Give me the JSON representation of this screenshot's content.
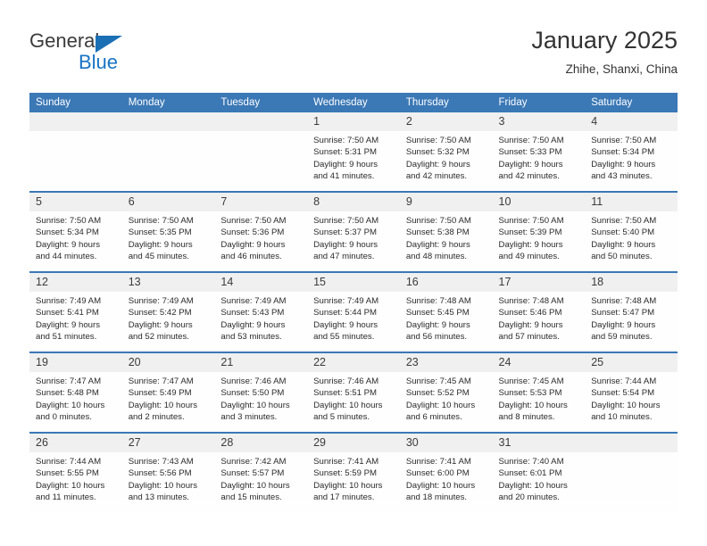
{
  "logo": {
    "word_top": "General",
    "word_bottom": "Blue",
    "triangle_icon": "triangle-icon",
    "accent_color": "#1874c4"
  },
  "header": {
    "title": "January 2025",
    "location": "Zhihe, Shanxi, China"
  },
  "calendar": {
    "header_bg": "#3b78b6",
    "daynum_bg": "#f0f0f0",
    "weekdays": [
      "Sunday",
      "Monday",
      "Tuesday",
      "Wednesday",
      "Thursday",
      "Friday",
      "Saturday"
    ],
    "weeks": [
      [
        {
          "day": "",
          "sunrise": "",
          "sunset": "",
          "daylight_line1": "",
          "daylight_line2": "",
          "empty": true
        },
        {
          "day": "",
          "sunrise": "",
          "sunset": "",
          "daylight_line1": "",
          "daylight_line2": "",
          "empty": true
        },
        {
          "day": "",
          "sunrise": "",
          "sunset": "",
          "daylight_line1": "",
          "daylight_line2": "",
          "empty": true
        },
        {
          "day": "1",
          "sunrise": "Sunrise: 7:50 AM",
          "sunset": "Sunset: 5:31 PM",
          "daylight_line1": "Daylight: 9 hours",
          "daylight_line2": "and 41 minutes."
        },
        {
          "day": "2",
          "sunrise": "Sunrise: 7:50 AM",
          "sunset": "Sunset: 5:32 PM",
          "daylight_line1": "Daylight: 9 hours",
          "daylight_line2": "and 42 minutes."
        },
        {
          "day": "3",
          "sunrise": "Sunrise: 7:50 AM",
          "sunset": "Sunset: 5:33 PM",
          "daylight_line1": "Daylight: 9 hours",
          "daylight_line2": "and 42 minutes."
        },
        {
          "day": "4",
          "sunrise": "Sunrise: 7:50 AM",
          "sunset": "Sunset: 5:34 PM",
          "daylight_line1": "Daylight: 9 hours",
          "daylight_line2": "and 43 minutes."
        }
      ],
      [
        {
          "day": "5",
          "sunrise": "Sunrise: 7:50 AM",
          "sunset": "Sunset: 5:34 PM",
          "daylight_line1": "Daylight: 9 hours",
          "daylight_line2": "and 44 minutes."
        },
        {
          "day": "6",
          "sunrise": "Sunrise: 7:50 AM",
          "sunset": "Sunset: 5:35 PM",
          "daylight_line1": "Daylight: 9 hours",
          "daylight_line2": "and 45 minutes."
        },
        {
          "day": "7",
          "sunrise": "Sunrise: 7:50 AM",
          "sunset": "Sunset: 5:36 PM",
          "daylight_line1": "Daylight: 9 hours",
          "daylight_line2": "and 46 minutes."
        },
        {
          "day": "8",
          "sunrise": "Sunrise: 7:50 AM",
          "sunset": "Sunset: 5:37 PM",
          "daylight_line1": "Daylight: 9 hours",
          "daylight_line2": "and 47 minutes."
        },
        {
          "day": "9",
          "sunrise": "Sunrise: 7:50 AM",
          "sunset": "Sunset: 5:38 PM",
          "daylight_line1": "Daylight: 9 hours",
          "daylight_line2": "and 48 minutes."
        },
        {
          "day": "10",
          "sunrise": "Sunrise: 7:50 AM",
          "sunset": "Sunset: 5:39 PM",
          "daylight_line1": "Daylight: 9 hours",
          "daylight_line2": "and 49 minutes."
        },
        {
          "day": "11",
          "sunrise": "Sunrise: 7:50 AM",
          "sunset": "Sunset: 5:40 PM",
          "daylight_line1": "Daylight: 9 hours",
          "daylight_line2": "and 50 minutes."
        }
      ],
      [
        {
          "day": "12",
          "sunrise": "Sunrise: 7:49 AM",
          "sunset": "Sunset: 5:41 PM",
          "daylight_line1": "Daylight: 9 hours",
          "daylight_line2": "and 51 minutes."
        },
        {
          "day": "13",
          "sunrise": "Sunrise: 7:49 AM",
          "sunset": "Sunset: 5:42 PM",
          "daylight_line1": "Daylight: 9 hours",
          "daylight_line2": "and 52 minutes."
        },
        {
          "day": "14",
          "sunrise": "Sunrise: 7:49 AM",
          "sunset": "Sunset: 5:43 PM",
          "daylight_line1": "Daylight: 9 hours",
          "daylight_line2": "and 53 minutes."
        },
        {
          "day": "15",
          "sunrise": "Sunrise: 7:49 AM",
          "sunset": "Sunset: 5:44 PM",
          "daylight_line1": "Daylight: 9 hours",
          "daylight_line2": "and 55 minutes."
        },
        {
          "day": "16",
          "sunrise": "Sunrise: 7:48 AM",
          "sunset": "Sunset: 5:45 PM",
          "daylight_line1": "Daylight: 9 hours",
          "daylight_line2": "and 56 minutes."
        },
        {
          "day": "17",
          "sunrise": "Sunrise: 7:48 AM",
          "sunset": "Sunset: 5:46 PM",
          "daylight_line1": "Daylight: 9 hours",
          "daylight_line2": "and 57 minutes."
        },
        {
          "day": "18",
          "sunrise": "Sunrise: 7:48 AM",
          "sunset": "Sunset: 5:47 PM",
          "daylight_line1": "Daylight: 9 hours",
          "daylight_line2": "and 59 minutes."
        }
      ],
      [
        {
          "day": "19",
          "sunrise": "Sunrise: 7:47 AM",
          "sunset": "Sunset: 5:48 PM",
          "daylight_line1": "Daylight: 10 hours",
          "daylight_line2": "and 0 minutes."
        },
        {
          "day": "20",
          "sunrise": "Sunrise: 7:47 AM",
          "sunset": "Sunset: 5:49 PM",
          "daylight_line1": "Daylight: 10 hours",
          "daylight_line2": "and 2 minutes."
        },
        {
          "day": "21",
          "sunrise": "Sunrise: 7:46 AM",
          "sunset": "Sunset: 5:50 PM",
          "daylight_line1": "Daylight: 10 hours",
          "daylight_line2": "and 3 minutes."
        },
        {
          "day": "22",
          "sunrise": "Sunrise: 7:46 AM",
          "sunset": "Sunset: 5:51 PM",
          "daylight_line1": "Daylight: 10 hours",
          "daylight_line2": "and 5 minutes."
        },
        {
          "day": "23",
          "sunrise": "Sunrise: 7:45 AM",
          "sunset": "Sunset: 5:52 PM",
          "daylight_line1": "Daylight: 10 hours",
          "daylight_line2": "and 6 minutes."
        },
        {
          "day": "24",
          "sunrise": "Sunrise: 7:45 AM",
          "sunset": "Sunset: 5:53 PM",
          "daylight_line1": "Daylight: 10 hours",
          "daylight_line2": "and 8 minutes."
        },
        {
          "day": "25",
          "sunrise": "Sunrise: 7:44 AM",
          "sunset": "Sunset: 5:54 PM",
          "daylight_line1": "Daylight: 10 hours",
          "daylight_line2": "and 10 minutes."
        }
      ],
      [
        {
          "day": "26",
          "sunrise": "Sunrise: 7:44 AM",
          "sunset": "Sunset: 5:55 PM",
          "daylight_line1": "Daylight: 10 hours",
          "daylight_line2": "and 11 minutes."
        },
        {
          "day": "27",
          "sunrise": "Sunrise: 7:43 AM",
          "sunset": "Sunset: 5:56 PM",
          "daylight_line1": "Daylight: 10 hours",
          "daylight_line2": "and 13 minutes."
        },
        {
          "day": "28",
          "sunrise": "Sunrise: 7:42 AM",
          "sunset": "Sunset: 5:57 PM",
          "daylight_line1": "Daylight: 10 hours",
          "daylight_line2": "and 15 minutes."
        },
        {
          "day": "29",
          "sunrise": "Sunrise: 7:41 AM",
          "sunset": "Sunset: 5:59 PM",
          "daylight_line1": "Daylight: 10 hours",
          "daylight_line2": "and 17 minutes."
        },
        {
          "day": "30",
          "sunrise": "Sunrise: 7:41 AM",
          "sunset": "Sunset: 6:00 PM",
          "daylight_line1": "Daylight: 10 hours",
          "daylight_line2": "and 18 minutes."
        },
        {
          "day": "31",
          "sunrise": "Sunrise: 7:40 AM",
          "sunset": "Sunset: 6:01 PM",
          "daylight_line1": "Daylight: 10 hours",
          "daylight_line2": "and 20 minutes."
        },
        {
          "day": "",
          "sunrise": "",
          "sunset": "",
          "daylight_line1": "",
          "daylight_line2": "",
          "empty": true
        }
      ]
    ]
  }
}
